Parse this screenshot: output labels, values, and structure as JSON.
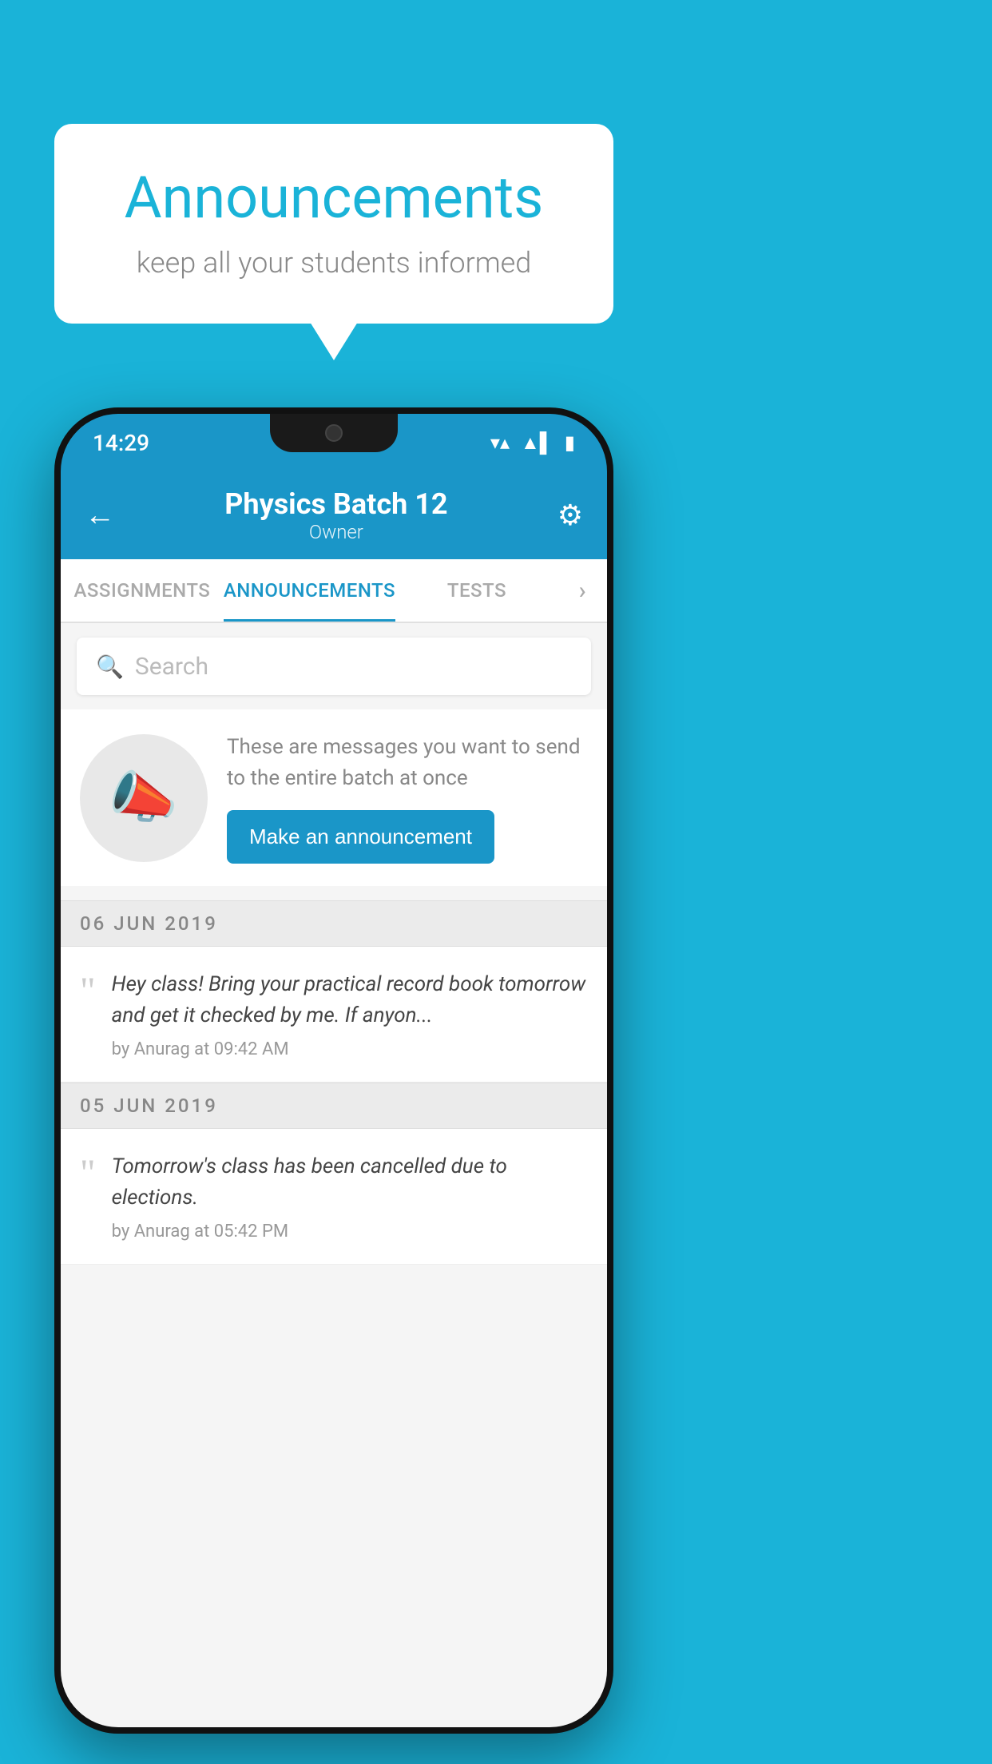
{
  "background_color": "#1ab3d8",
  "speech_bubble": {
    "title": "Announcements",
    "subtitle": "keep all your students informed"
  },
  "phone": {
    "status_bar": {
      "time": "14:29",
      "wifi_icon": "▼",
      "signal_icon": "▲",
      "battery_icon": "▮"
    },
    "header": {
      "back_label": "←",
      "title": "Physics Batch 12",
      "subtitle": "Owner",
      "gear_label": "⚙"
    },
    "tabs": [
      {
        "label": "ASSIGNMENTS",
        "active": false
      },
      {
        "label": "ANNOUNCEMENTS",
        "active": true
      },
      {
        "label": "TESTS",
        "active": false
      },
      {
        "label": "›",
        "active": false
      }
    ],
    "search": {
      "placeholder": "Search"
    },
    "promo": {
      "description": "These are messages you want to send to the entire batch at once",
      "button_label": "Make an announcement"
    },
    "announcements": [
      {
        "date": "06  JUN  2019",
        "text": "Hey class! Bring your practical record book tomorrow and get it checked by me. If anyon...",
        "meta": "by Anurag at 09:42 AM"
      },
      {
        "date": "05  JUN  2019",
        "text": "Tomorrow's class has been cancelled due to elections.",
        "meta": "by Anurag at 05:42 PM"
      }
    ]
  }
}
